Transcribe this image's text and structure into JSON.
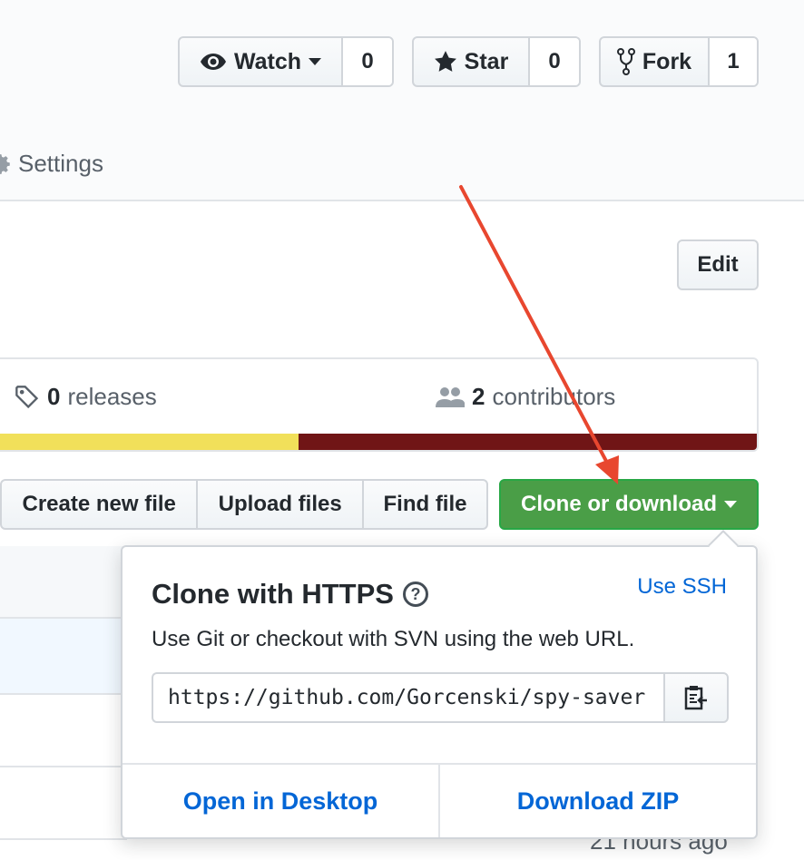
{
  "header": {
    "watch": {
      "label": "Watch",
      "count": "0"
    },
    "star": {
      "label": "Star",
      "count": "0"
    },
    "fork": {
      "label": "Fork",
      "count": "1"
    }
  },
  "nav": {
    "settings_label": "Settings"
  },
  "edit_label": "Edit",
  "summary": {
    "releases_count": "0",
    "releases_label": "releases",
    "contributors_count": "2",
    "contributors_label": "contributors",
    "language_colors": [
      "#f1e05a",
      "#701516"
    ],
    "language_fractions": [
      0.4,
      0.6
    ]
  },
  "file_buttons": {
    "create": "Create new file",
    "upload": "Upload files",
    "find": "Find file"
  },
  "clone_button": {
    "label": "Clone or download",
    "color": "#4a9e47"
  },
  "clone_panel": {
    "title": "Clone with HTTPS",
    "use_ssh": "Use SSH",
    "description": "Use Git or checkout with SVN using the web URL.",
    "url": "https://github.com/Gorcenski/spy-saver.git",
    "open_desktop": "Open in Desktop",
    "download_zip": "Download ZIP"
  },
  "timestamp": "21 hours ago",
  "annotation": {
    "arrow_color": "#e8472f"
  }
}
